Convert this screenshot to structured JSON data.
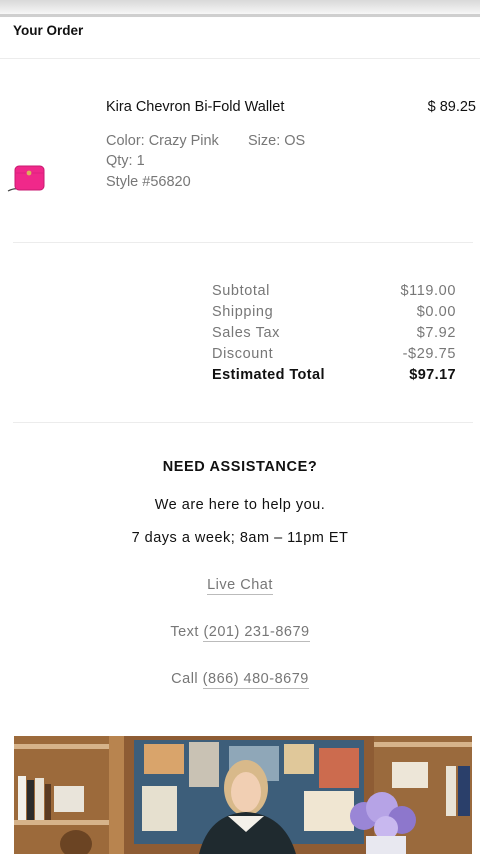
{
  "header": {
    "title": "Your Order"
  },
  "item": {
    "name": "Kira Chevron Bi-Fold Wallet",
    "price": "$ 89.25",
    "color": "Color: Crazy Pink",
    "size": "Size: OS",
    "qty": "Qty: 1",
    "style": "Style #56820",
    "image_color": "#f0288a"
  },
  "totals": {
    "rows": [
      {
        "label": "Subtotal",
        "value": "$119.00"
      },
      {
        "label": "Shipping",
        "value": "$0.00"
      },
      {
        "label": "Sales Tax",
        "value": "$7.92"
      },
      {
        "label": "Discount",
        "value": "-$29.75"
      }
    ],
    "total_label": "Estimated Total",
    "total_value": "$97.17"
  },
  "assistance": {
    "title": "NEED ASSISTANCE?",
    "line1": "We are here to help you.",
    "line2": "7 days a week; 8am – 11pm ET",
    "chat": "Live Chat",
    "text_label": "Text",
    "text_number": "(201) 231-8679",
    "call_label": "Call",
    "call_number": "(866) 480-8679"
  }
}
